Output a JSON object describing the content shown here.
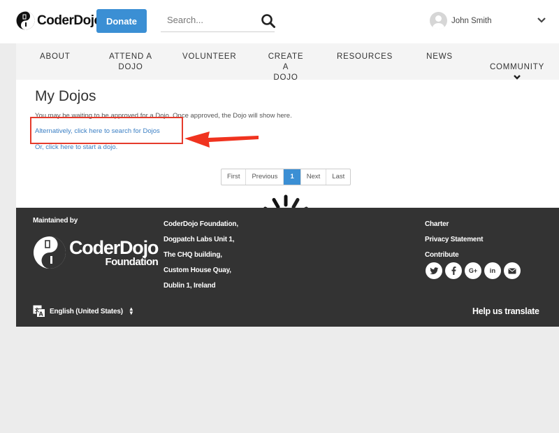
{
  "header": {
    "logo_text": "CoderDojo",
    "donate_label": "Donate",
    "search_placeholder": "Search...",
    "user_name": "John Smith"
  },
  "nav": {
    "items": [
      {
        "label": "ABOUT"
      },
      {
        "label": "ATTEND A\nDOJO"
      },
      {
        "label": "VOLUNTEER"
      },
      {
        "label": "CREATE A\nDOJO"
      },
      {
        "label": "RESOURCES"
      },
      {
        "label": "NEWS"
      },
      {
        "label": "COMMUNITY"
      }
    ]
  },
  "main": {
    "title": "My Dojos",
    "message": "You may be waiting to be approved for a Dojo. Once approved, the Dojo will show here.",
    "search_link": "Alternatively, click here to search for Dojos",
    "start_link": "Or, click here to start a dojo.",
    "pagination": [
      "First",
      "Previous",
      "1",
      "Next",
      "Last"
    ],
    "active_page": "1"
  },
  "footer": {
    "maintained_by": "Maintained by",
    "logo_big": "CoderDojo",
    "logo_small": "Foundation",
    "address": [
      "CoderDojo Foundation,",
      "Dogpatch Labs Unit 1,",
      "The CHQ building,",
      "Custom House Quay,",
      "Dublin 1, Ireland"
    ],
    "links": [
      "Charter",
      "Privacy Statement",
      "Contribute"
    ],
    "social": [
      "twitter-icon",
      "facebook-icon",
      "google-plus-icon",
      "linkedin-icon",
      "email-icon"
    ],
    "language": "English (United States)",
    "help_translate": "Help us translate"
  },
  "colors": {
    "accent": "#3b8fd4",
    "highlight": "#e53b2c",
    "footer_bg": "#333333"
  }
}
